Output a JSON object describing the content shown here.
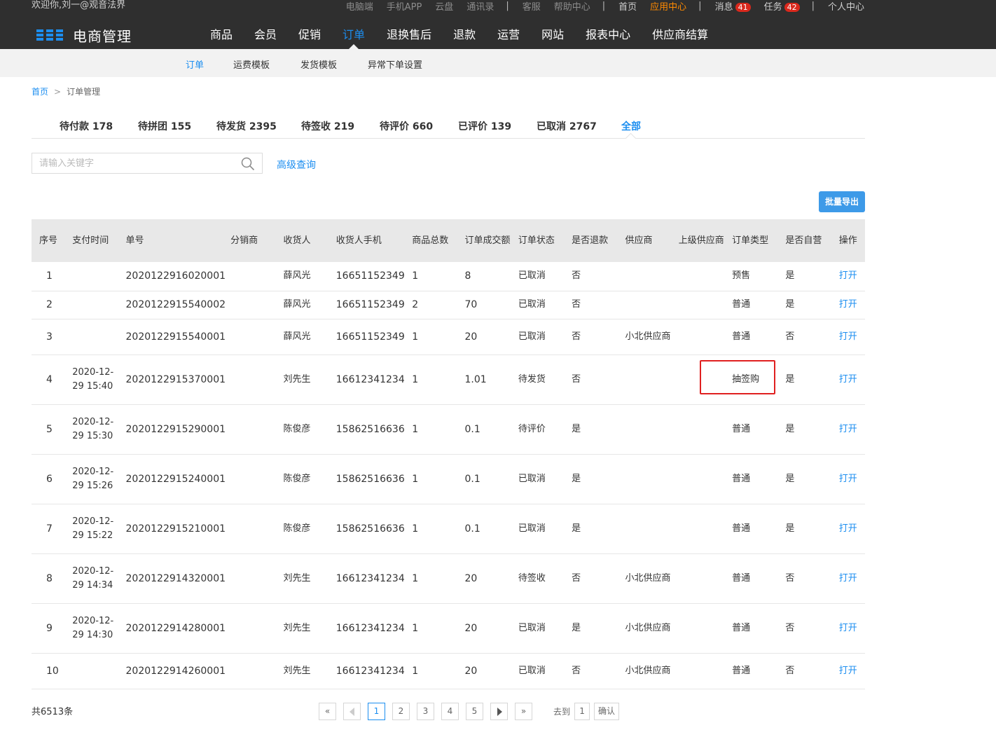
{
  "header": {
    "welcome": "欢迎你,刘一@观音法界",
    "links": [
      "电脑端",
      "手机APP",
      "云盘",
      "通讯录"
    ],
    "links2": [
      "客服",
      "帮助中心"
    ],
    "home": "首页",
    "app_center": "应用中心",
    "messages": "消息",
    "messages_count": "41",
    "tasks": "任务",
    "tasks_count": "42",
    "profile": "个人中心",
    "separator": "|"
  },
  "brand": {
    "name": "电商管理",
    "color": "#1c8ef0"
  },
  "nav": [
    "商品",
    "会员",
    "促销",
    "订单",
    "退换售后",
    "退款",
    "运营",
    "网站",
    "报表中心",
    "供应商结算"
  ],
  "nav_active": "订单",
  "subnav": [
    "订单",
    "运费模板",
    "发货模板",
    "异常下单设置"
  ],
  "breadcrumb": {
    "home": "首页",
    "sep": ">",
    "current": "订单管理"
  },
  "status_tabs": [
    "待付款 178",
    "待拼团 155",
    "待发货 2395",
    "待签收 219",
    "待评价 660",
    "已评价 139",
    "已取消 2767",
    "全部"
  ],
  "search": {
    "placeholder": "请输入关键字",
    "advanced": "高级查询",
    "icon": "search-icon"
  },
  "export_label": "批量导出",
  "table": {
    "headers": [
      "序号",
      "支付时间",
      "单号",
      "分销商",
      "收货人",
      "收货人手机",
      "商品总数",
      "订单成交额",
      "订单状态",
      "是否退款",
      "供应商",
      "上级供应商",
      "订单类型",
      "是否自营",
      "操作"
    ],
    "rows": [
      [
        "1",
        "",
        "2020122916020001",
        "",
        "薛风光",
        "16651152349",
        "1",
        "8",
        "已取消",
        "否",
        "",
        "",
        "预售",
        "是",
        "打开"
      ],
      [
        "2",
        "",
        "2020122915540002",
        "",
        "薛风光",
        "16651152349",
        "2",
        "70",
        "已取消",
        "否",
        "",
        "",
        "普通",
        "是",
        "打开"
      ],
      [
        "3",
        "",
        "2020122915540001",
        "",
        "薛风光",
        "16651152349",
        "1",
        "20",
        "已取消",
        "否",
        "小北供应商",
        "",
        "普通",
        "否",
        "打开"
      ],
      [
        "4",
        "2020-12-29 15:40",
        "2020122915370001",
        "",
        "刘先生",
        "16612341234",
        "1",
        "1.01",
        "待发货",
        "否",
        "",
        "",
        "抽签购",
        "是",
        "打开"
      ],
      [
        "5",
        "2020-12-29 15:30",
        "2020122915290001",
        "",
        "陈俊彦",
        "15862516636",
        "1",
        "0.1",
        "待评价",
        "是",
        "",
        "",
        "普通",
        "是",
        "打开"
      ],
      [
        "6",
        "2020-12-29 15:26",
        "2020122915240001",
        "",
        "陈俊彦",
        "15862516636",
        "1",
        "0.1",
        "已取消",
        "是",
        "",
        "",
        "普通",
        "是",
        "打开"
      ],
      [
        "7",
        "2020-12-29 15:22",
        "2020122915210001",
        "",
        "陈俊彦",
        "15862516636",
        "1",
        "0.1",
        "已取消",
        "是",
        "",
        "",
        "普通",
        "是",
        "打开"
      ],
      [
        "8",
        "2020-12-29 14:34",
        "2020122914320001",
        "",
        "刘先生",
        "16612341234",
        "1",
        "20",
        "待签收",
        "否",
        "小北供应商",
        "",
        "普通",
        "否",
        "打开"
      ],
      [
        "9",
        "2020-12-29 14:30",
        "2020122914280001",
        "",
        "刘先生",
        "16612341234",
        "1",
        "20",
        "已取消",
        "是",
        "小北供应商",
        "",
        "普通",
        "否",
        "打开"
      ],
      [
        "10",
        "",
        "2020122914260001",
        "",
        "刘先生",
        "16612341234",
        "1",
        "20",
        "已取消",
        "否",
        "小北供应商",
        "",
        "普通",
        "否",
        "打开"
      ]
    ]
  },
  "footer": {
    "total": "共6513条",
    "first": "«",
    "last": "»",
    "pages": [
      "1",
      "2",
      "3",
      "4",
      "5"
    ],
    "current_page": "1",
    "goto_label": "去到",
    "goto_value": "1",
    "confirm": "确认"
  },
  "colors": {
    "accent": "#1c8ef0",
    "topbar": "#2f2f2f",
    "highlight": "#e02020",
    "badge": "#d9281c"
  }
}
